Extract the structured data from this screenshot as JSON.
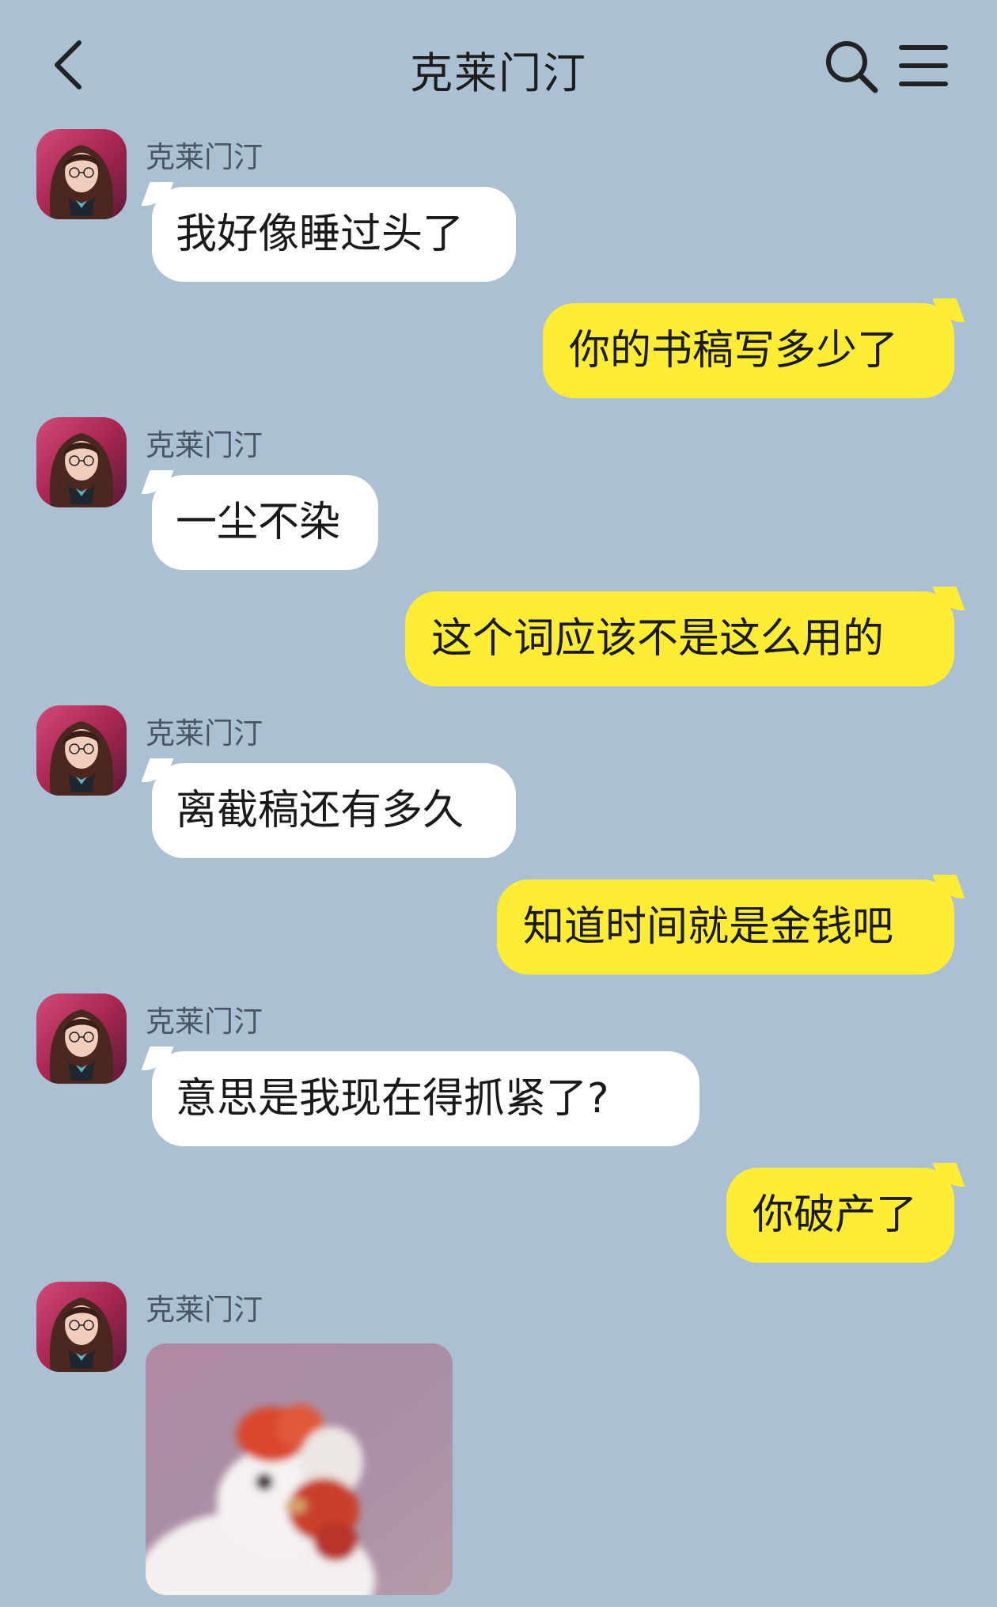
{
  "header": {
    "title": "克莱门汀"
  },
  "messages": [
    {
      "sender": "克莱门汀",
      "text": "我好像睡过头了"
    },
    {
      "text": "你的书稿写多少了"
    },
    {
      "sender": "克莱门汀",
      "text": "一尘不染"
    },
    {
      "text": "这个词应该不是这么用的"
    },
    {
      "sender": "克莱门汀",
      "text": "离截稿还有多久"
    },
    {
      "text": "知道时间就是金钱吧"
    },
    {
      "sender": "克莱门汀",
      "text": "意思是我现在得抓紧了?"
    },
    {
      "text": "你破产了"
    },
    {
      "sender": "克莱门汀"
    }
  ],
  "icons": {
    "back": "chevron-left-icon",
    "search": "search-icon",
    "menu": "menu-icon"
  },
  "colors": {
    "background": "#abc1d3",
    "incoming_bubble": "#ffffff",
    "outgoing_bubble": "#ffec35"
  }
}
